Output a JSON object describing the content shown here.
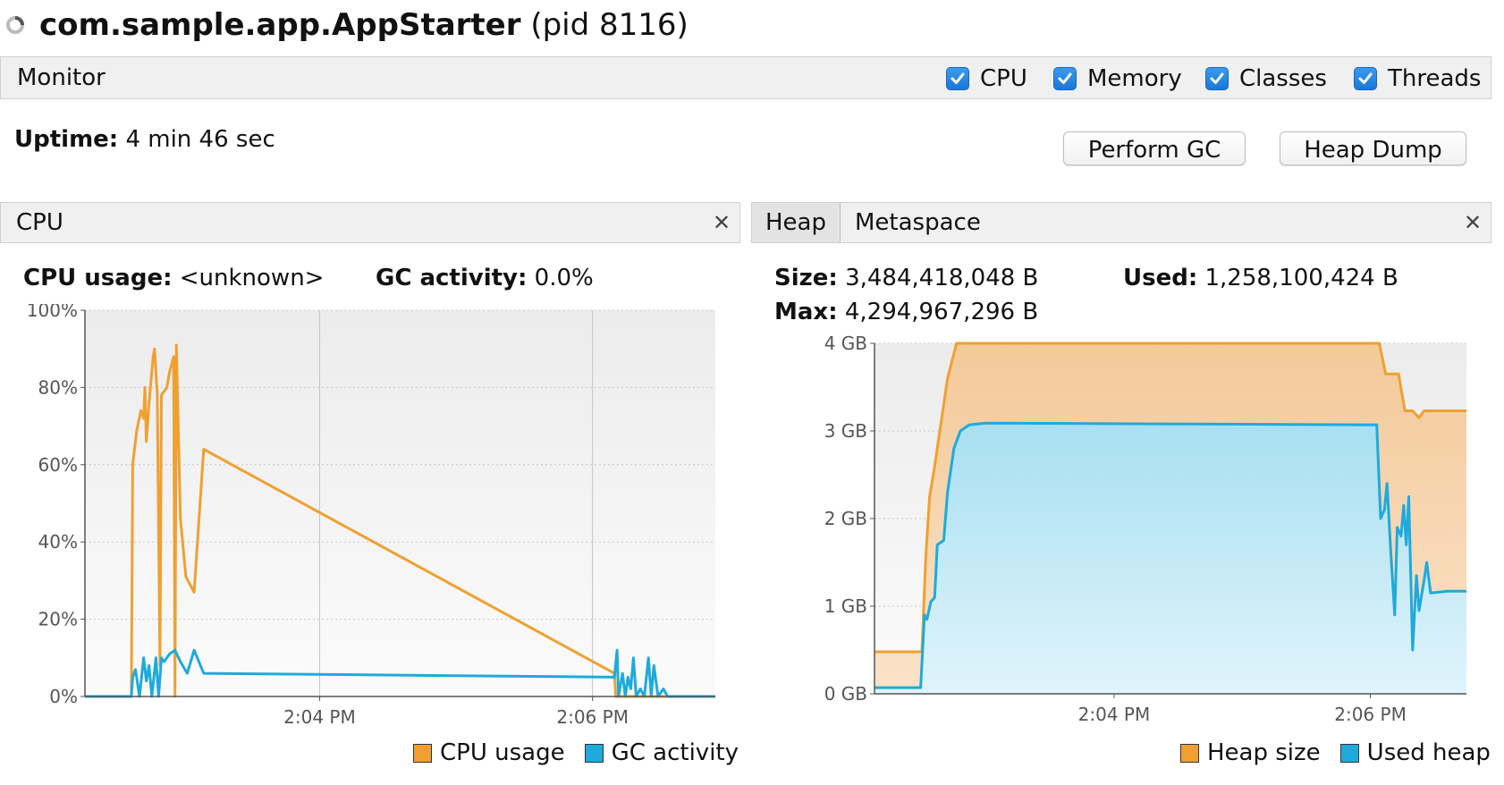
{
  "window": {
    "app_name": "com.sample.app.AppStarter",
    "pid_text": "(pid 8116)"
  },
  "monitor": {
    "label": "Monitor",
    "checkboxes": [
      {
        "label": "CPU",
        "checked": true
      },
      {
        "label": "Memory",
        "checked": true
      },
      {
        "label": "Classes",
        "checked": true
      },
      {
        "label": "Threads",
        "checked": true
      }
    ],
    "uptime_label": "Uptime:",
    "uptime_value": "4 min 46 sec",
    "perform_gc": "Perform GC",
    "heap_dump": "Heap Dump"
  },
  "colors": {
    "orange": "#f0a030",
    "blue": "#1eaadc",
    "plot_bg": "#f6f6f6"
  },
  "cpu_panel": {
    "tab": "CPU",
    "cpu_usage_label": "CPU usage:",
    "cpu_usage_value": "<unknown>",
    "gc_label": "GC activity:",
    "gc_value": "0.0%",
    "legend": [
      "CPU usage",
      "GC activity"
    ]
  },
  "heap_panel": {
    "tabs": [
      "Heap",
      "Metaspace"
    ],
    "size_label": "Size:",
    "size_value": "3,484,418,048 B",
    "used_label": "Used:",
    "used_value": "1,258,100,424 B",
    "max_label": "Max:",
    "max_value": "4,294,967,296 B",
    "legend": [
      "Heap size",
      "Used heap"
    ]
  },
  "chart_data": [
    {
      "type": "line",
      "xlabel": "",
      "ylabel": "",
      "x_unit": "minutes since 2:00 PM",
      "xlim": [
        2.28,
        6.9
      ],
      "ylim": [
        0,
        100
      ],
      "yticks": [
        "0%",
        "20%",
        "40%",
        "60%",
        "80%",
        "100%"
      ],
      "xticks": [
        {
          "x": 4,
          "label": "2:04 PM"
        },
        {
          "x": 6,
          "label": "2:06 PM"
        }
      ],
      "grid": true,
      "legend_position": "bottom-right",
      "series": [
        {
          "name": "CPU usage",
          "color": "#f0a030",
          "points": [
            [
              2.28,
              0
            ],
            [
              2.62,
              0
            ],
            [
              2.63,
              60
            ],
            [
              2.66,
              69
            ],
            [
              2.69,
              74
            ],
            [
              2.71,
              72
            ],
            [
              2.72,
              80
            ],
            [
              2.73,
              66
            ],
            [
              2.75,
              76
            ],
            [
              2.78,
              88
            ],
            [
              2.79,
              90
            ],
            [
              2.81,
              78
            ],
            [
              2.83,
              8
            ],
            [
              2.84,
              78
            ],
            [
              2.86,
              79
            ],
            [
              2.88,
              80
            ],
            [
              2.9,
              84
            ],
            [
              2.93,
              88
            ],
            [
              2.94,
              0
            ],
            [
              2.95,
              91
            ],
            [
              2.98,
              46
            ],
            [
              3.02,
              31
            ],
            [
              3.08,
              27
            ],
            [
              3.15,
              64
            ],
            [
              6.16,
              6
            ],
            [
              6.17,
              0
            ],
            [
              6.9,
              0
            ]
          ]
        },
        {
          "name": "GC activity",
          "color": "#1eaadc",
          "points": [
            [
              2.28,
              0
            ],
            [
              2.62,
              0
            ],
            [
              2.63,
              5
            ],
            [
              2.65,
              7
            ],
            [
              2.68,
              0
            ],
            [
              2.71,
              10
            ],
            [
              2.73,
              4
            ],
            [
              2.75,
              8
            ],
            [
              2.77,
              0
            ],
            [
              2.8,
              10
            ],
            [
              2.82,
              0
            ],
            [
              2.84,
              10
            ],
            [
              2.86,
              9
            ],
            [
              2.88,
              10
            ],
            [
              2.9,
              11
            ],
            [
              2.94,
              12
            ],
            [
              2.98,
              9
            ],
            [
              3.03,
              6
            ],
            [
              3.08,
              12
            ],
            [
              3.15,
              6
            ],
            [
              6.16,
              5
            ],
            [
              6.18,
              12
            ],
            [
              6.19,
              0
            ],
            [
              6.21,
              4
            ],
            [
              6.22,
              6
            ],
            [
              6.24,
              0
            ],
            [
              6.26,
              5
            ],
            [
              6.28,
              2
            ],
            [
              6.3,
              10
            ],
            [
              6.32,
              0
            ],
            [
              6.35,
              2
            ],
            [
              6.38,
              0
            ],
            [
              6.41,
              10
            ],
            [
              6.43,
              0
            ],
            [
              6.45,
              8
            ],
            [
              6.48,
              0
            ],
            [
              6.52,
              2
            ],
            [
              6.55,
              0
            ],
            [
              6.9,
              0
            ]
          ]
        }
      ]
    },
    {
      "type": "area",
      "xlabel": "",
      "ylabel": "",
      "x_unit": "minutes since 2:00 PM",
      "xlim": [
        2.13,
        6.75
      ],
      "ylim": [
        0,
        4
      ],
      "yticks": [
        "0 GB",
        "1 GB",
        "2 GB",
        "3 GB",
        "4 GB"
      ],
      "xticks": [
        {
          "x": 4,
          "label": "2:04 PM"
        },
        {
          "x": 6,
          "label": "2:06 PM"
        }
      ],
      "grid": true,
      "legend_position": "bottom-right",
      "series": [
        {
          "name": "Heap size",
          "color": "#f0a030",
          "points": [
            [
              2.13,
              0.48
            ],
            [
              2.5,
              0.48
            ],
            [
              2.53,
              1.55
            ],
            [
              2.56,
              2.25
            ],
            [
              2.6,
              2.6
            ],
            [
              2.65,
              3.1
            ],
            [
              2.7,
              3.6
            ],
            [
              2.77,
              4.0
            ],
            [
              6.07,
              4.0
            ],
            [
              6.12,
              3.65
            ],
            [
              6.22,
              3.65
            ],
            [
              6.27,
              3.23
            ],
            [
              6.33,
              3.23
            ],
            [
              6.38,
              3.15
            ],
            [
              6.42,
              3.23
            ],
            [
              6.75,
              3.23
            ]
          ]
        },
        {
          "name": "Used heap",
          "color": "#1eaadc",
          "points": [
            [
              2.13,
              0.07
            ],
            [
              2.49,
              0.07
            ],
            [
              2.52,
              0.9
            ],
            [
              2.54,
              0.85
            ],
            [
              2.57,
              1.05
            ],
            [
              2.6,
              1.1
            ],
            [
              2.62,
              1.7
            ],
            [
              2.67,
              1.75
            ],
            [
              2.7,
              2.3
            ],
            [
              2.75,
              2.8
            ],
            [
              2.8,
              3.0
            ],
            [
              2.87,
              3.07
            ],
            [
              3.0,
              3.09
            ],
            [
              5.95,
              3.07
            ],
            [
              6.05,
              3.07
            ],
            [
              6.08,
              2.0
            ],
            [
              6.11,
              2.1
            ],
            [
              6.13,
              2.4
            ],
            [
              6.16,
              1.6
            ],
            [
              6.19,
              0.9
            ],
            [
              6.21,
              1.9
            ],
            [
              6.24,
              1.8
            ],
            [
              6.26,
              2.15
            ],
            [
              6.28,
              1.7
            ],
            [
              6.3,
              2.25
            ],
            [
              6.33,
              0.5
            ],
            [
              6.36,
              1.35
            ],
            [
              6.38,
              0.95
            ],
            [
              6.42,
              1.3
            ],
            [
              6.44,
              1.5
            ],
            [
              6.47,
              1.15
            ],
            [
              6.6,
              1.17
            ],
            [
              6.75,
              1.17
            ]
          ]
        }
      ]
    }
  ]
}
